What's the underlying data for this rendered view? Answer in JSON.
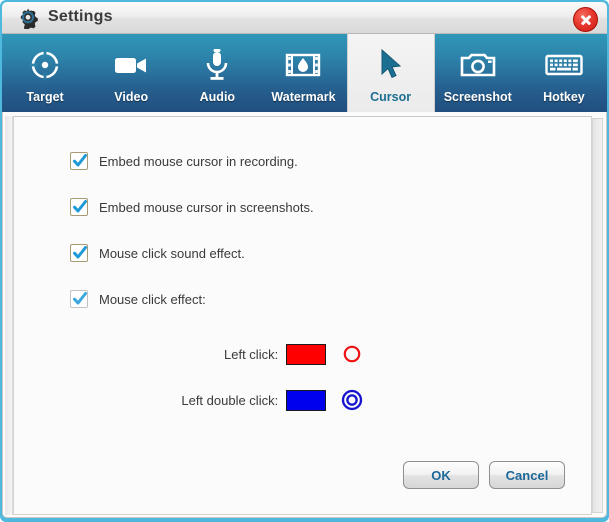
{
  "window": {
    "title": "Settings",
    "gear_icon": "gear-icon",
    "close_icon": "close-icon",
    "accent_color": "#2d85ab",
    "close_color": "#e8392f"
  },
  "tabs": [
    {
      "label": "Target",
      "icon": "target-icon",
      "active": false
    },
    {
      "label": "Video",
      "icon": "video-camera-icon",
      "active": false
    },
    {
      "label": "Audio",
      "icon": "microphone-icon",
      "active": false
    },
    {
      "label": "Watermark",
      "icon": "watermark-icon",
      "active": false
    },
    {
      "label": "Cursor",
      "icon": "cursor-arrow-icon",
      "active": true
    },
    {
      "label": "Screenshot",
      "icon": "camera-icon",
      "active": false
    },
    {
      "label": "Hotkey",
      "icon": "keyboard-icon",
      "active": false
    }
  ],
  "cursor_panel": {
    "checkboxes": [
      {
        "label": "Embed mouse cursor in recording.",
        "checked": true
      },
      {
        "label": "Embed mouse cursor in screenshots.",
        "checked": true
      },
      {
        "label": "Mouse click sound effect.",
        "checked": true
      },
      {
        "label": "Mouse click effect:",
        "checked": true
      }
    ],
    "click_effects": [
      {
        "label": "Left click:",
        "color": "#ff0000",
        "ring_style": "single-ring",
        "ring_color": "#ee1111"
      },
      {
        "label": "Left double click:",
        "color": "#0000ee",
        "ring_style": "double-ring",
        "ring_color": "#1414cc"
      }
    ]
  },
  "footer": {
    "ok_label": "OK",
    "cancel_label": "Cancel"
  }
}
